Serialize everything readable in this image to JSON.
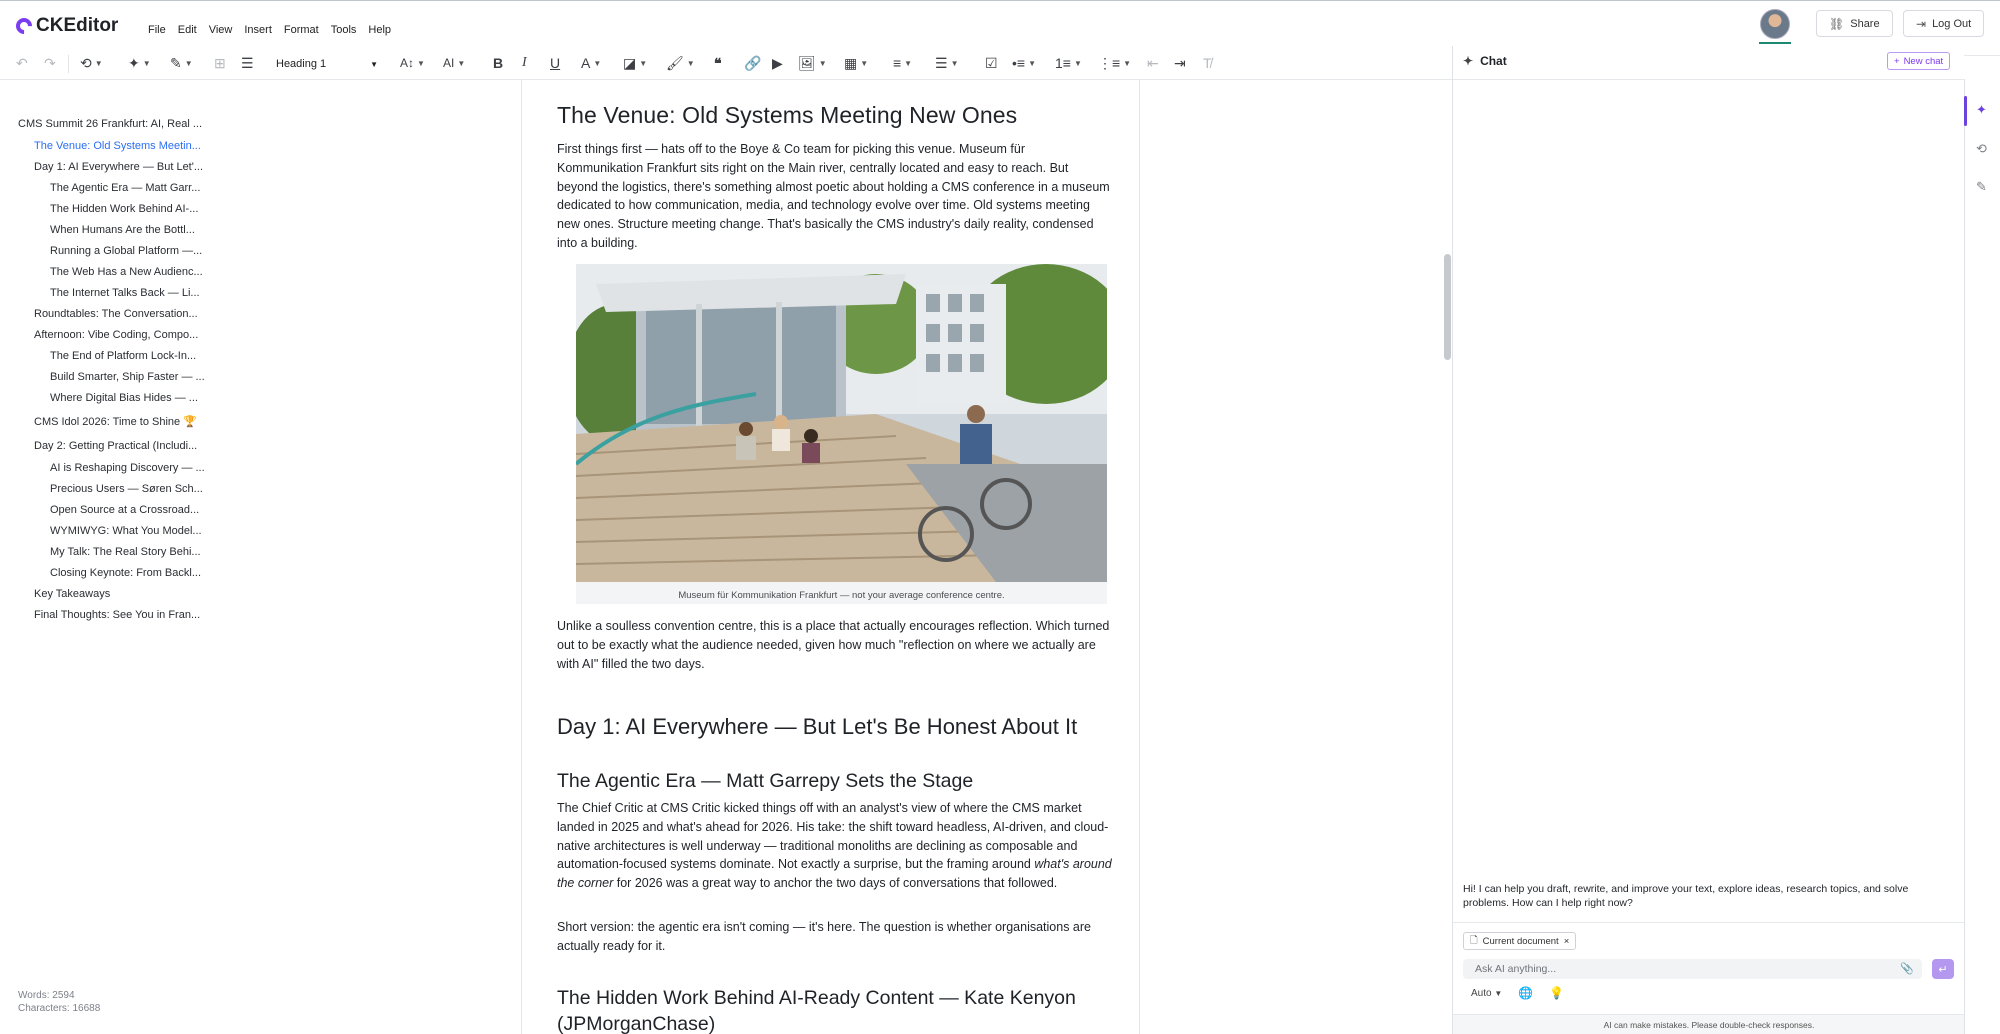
{
  "app": {
    "name": "CKEditor"
  },
  "menu": [
    "File",
    "Edit",
    "View",
    "Insert",
    "Format",
    "Tools",
    "Help"
  ],
  "header": {
    "share_label": "Share",
    "logout_label": "Log Out"
  },
  "toolbar": {
    "heading_value": "Heading 1"
  },
  "outline": [
    {
      "label": "CMS Summit 26 Frankfurt: AI, Real ...",
      "level": 0
    },
    {
      "label": "The Venue: Old Systems Meetin...",
      "level": 1,
      "active": true
    },
    {
      "label": "Day 1: AI Everywhere — But Let'...",
      "level": 1
    },
    {
      "label": "The Agentic Era — Matt Garr...",
      "level": 2
    },
    {
      "label": "The Hidden Work Behind AI-...",
      "level": 2
    },
    {
      "label": "When Humans Are the Bottl...",
      "level": 2
    },
    {
      "label": "Running a Global Platform —...",
      "level": 2
    },
    {
      "label": "The Web Has a New Audienc...",
      "level": 2
    },
    {
      "label": "The Internet Talks Back — Li...",
      "level": 2
    },
    {
      "label": "Roundtables: The Conversation...",
      "level": 1
    },
    {
      "label": "Afternoon: Vibe Coding, Compo...",
      "level": 1
    },
    {
      "label": "The End of Platform Lock-In...",
      "level": 2
    },
    {
      "label": "Build Smarter, Ship Faster — ...",
      "level": 2
    },
    {
      "label": "Where Digital Bias Hides — ...",
      "level": 2
    },
    {
      "label": "CMS Idol 2026: Time to Shine 🏆",
      "level": 1
    },
    {
      "label": "Day 2: Getting Practical (Includi...",
      "level": 1
    },
    {
      "label": "AI is Reshaping Discovery — ...",
      "level": 2
    },
    {
      "label": "Precious Users — Søren Sch...",
      "level": 2
    },
    {
      "label": "Open Source at a Crossroad...",
      "level": 2
    },
    {
      "label": "WYMIWYG: What You Model...",
      "level": 2
    },
    {
      "label": "My Talk: The Real Story Behi...",
      "level": 2
    },
    {
      "label": "Closing Keynote: From Backl...",
      "level": 2
    },
    {
      "label": "Key Takeaways",
      "level": 1
    },
    {
      "label": "Final Thoughts: See You in Fran...",
      "level": 1
    }
  ],
  "stats": {
    "words": "Words: 2594",
    "characters": "Characters: 16688"
  },
  "document": {
    "venue_heading": "The Venue: Old Systems Meeting New Ones",
    "venue_para": "First things first — hats off to the Boye & Co team for picking this venue. Museum für Kommunikation Frankfurt sits right on the Main river, centrally located and easy to reach. But beyond the logistics, there's something almost poetic about holding a CMS conference in a museum dedicated to how communication, media, and technology evolve over time. Old systems meeting new ones. Structure meeting change. That's basically the CMS industry's daily reality, condensed into a building.",
    "image_caption": "Museum für Kommunikation Frankfurt — not your average conference centre.",
    "reflection_para": "Unlike a soulless convention centre, this is a place that actually encourages reflection. Which turned out to be exactly what the audience needed, given how much \"reflection on where we actually are with AI\" filled the two days.",
    "day1_heading": "Day 1: AI Everywhere — But Let's Be Honest About It",
    "agentic_heading": "The Agentic Era — Matt Garrepy Sets the Stage",
    "agentic_para_a": "The Chief Critic at CMS Critic kicked things off with an analyst's view of where the CMS market landed in 2025 and what's ahead for 2026. His take: the shift toward headless, AI-driven, and cloud-native architectures is well underway — traditional monoliths are declining as composable and automation-focused systems dominate. Not exactly a surprise, but the framing around ",
    "agentic_para_em": "what's around the corner",
    "agentic_para_b": " for 2026 was a great way to anchor the two days of conversations that followed.",
    "short_para": "Short version: the agentic era isn't coming — it's here. The question is whether organisations are actually ready for it.",
    "hidden_heading_1": "The Hidden Work Behind AI-Ready Content — Kate Kenyon",
    "hidden_heading_2": "(JPMorganChase)"
  },
  "chat": {
    "title": "Chat",
    "new_chat_label": "New chat",
    "message": "Hi! I can help you draft, rewrite, and improve your text, explore ideas, research topics, and solve problems. How can I help right now?",
    "context_chip": "Current document",
    "input_placeholder": "Ask AI anything...",
    "model_value": "Auto",
    "disclaimer": "AI can make mistakes. Please double-check responses."
  },
  "colors": {
    "accent": "#7c3aed",
    "link": "#2b6ef5",
    "status_line": "#1c8a72"
  }
}
